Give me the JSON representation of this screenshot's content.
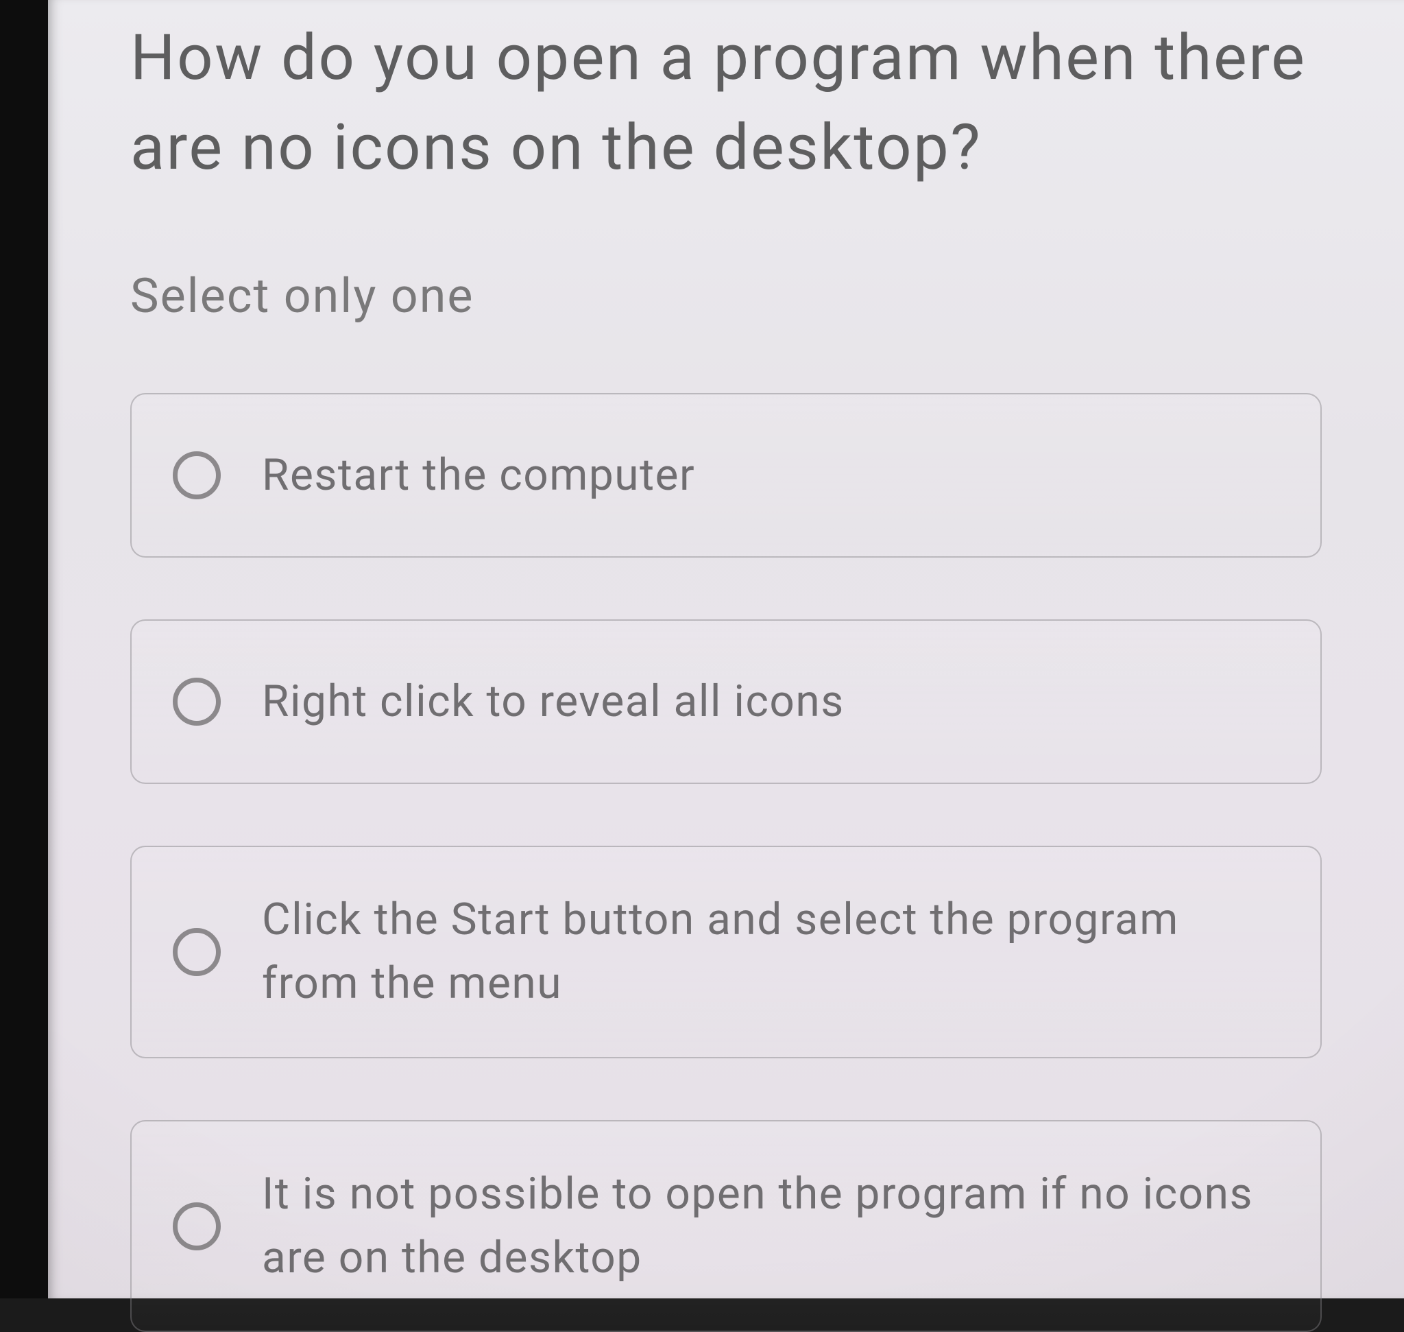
{
  "question": "How do you open a program when there are no icons on the desktop?",
  "instruction": "Select only one",
  "options": [
    {
      "label": "Restart the computer"
    },
    {
      "label": "Right click to reveal all icons"
    },
    {
      "label": "Click the Start button and select the program from the menu"
    },
    {
      "label": "It is not possible to open the program if no icons are on the desktop"
    }
  ]
}
